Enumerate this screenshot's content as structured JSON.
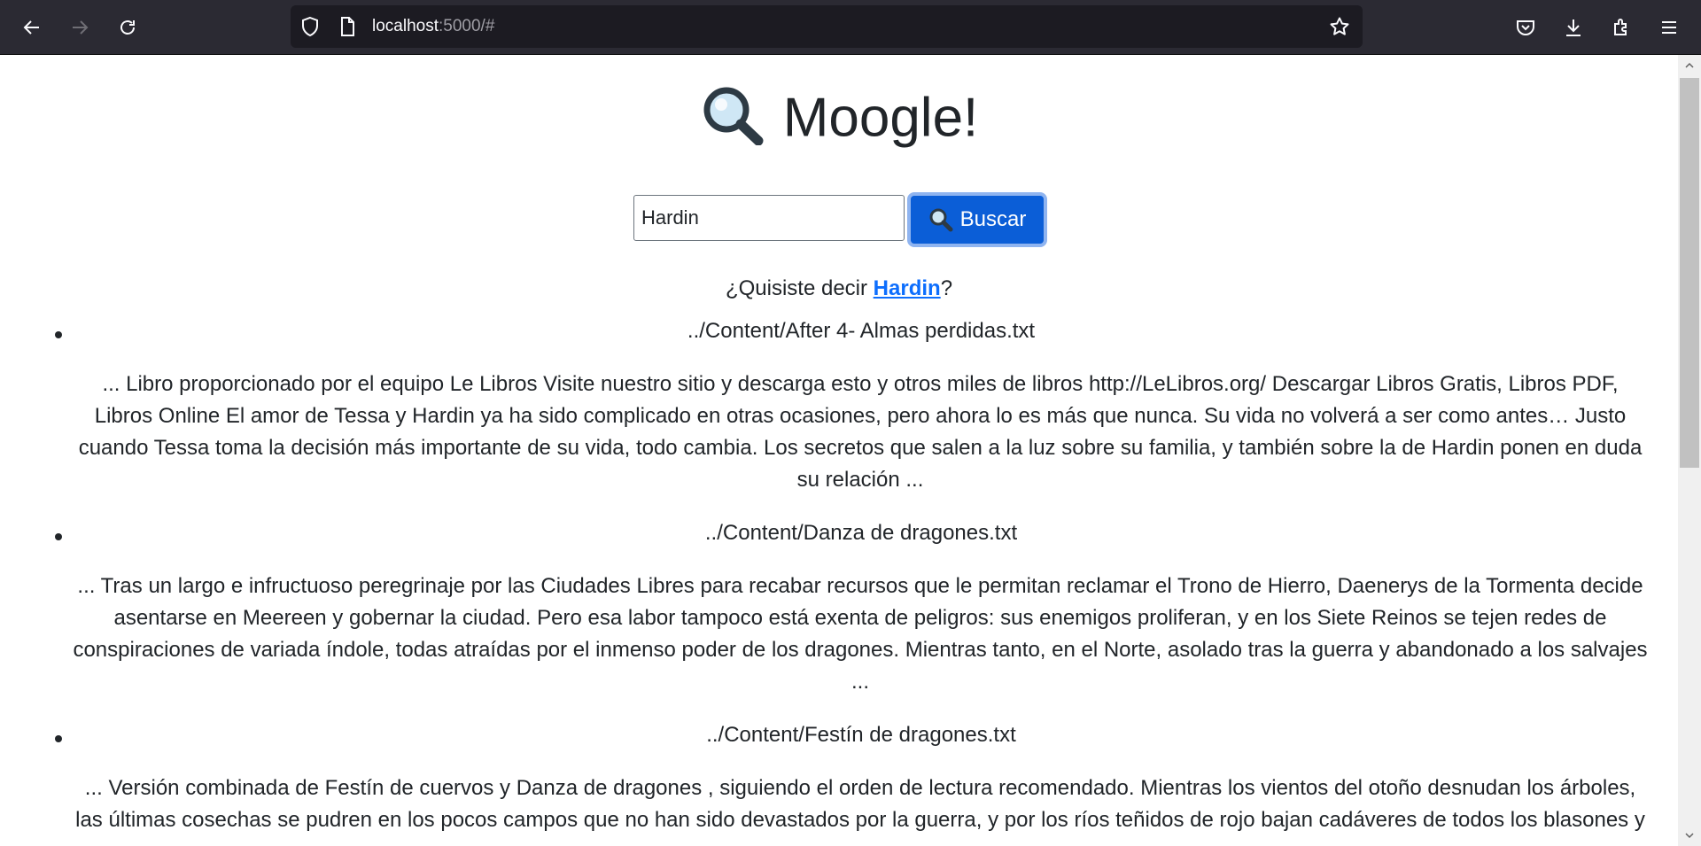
{
  "browser": {
    "url_host": "localhost",
    "url_rest": ":5000/#"
  },
  "page": {
    "title": "Moogle!",
    "search_value": "Hardin",
    "search_button_label": "Buscar",
    "suggest_prefix": "¿Quisiste decir ",
    "suggest_word": "Hardin",
    "suggest_suffix": "?",
    "results": [
      {
        "file": "../Content/After 4- Almas perdidas.txt",
        "snippet": "... Libro proporcionado por el equipo Le Libros Visite nuestro sitio y descarga esto y otros miles de libros http://LeLibros.org/ Descargar Libros Gratis, Libros PDF, Libros Online El amor de Tessa y Hardin ya ha sido complicado en otras ocasiones, pero ahora lo es más que nunca. Su vida no volverá a ser como antes… Justo cuando Tessa toma la decisión más importante de su vida, todo cambia. Los secretos que salen a la luz sobre su familia, y también sobre la de Hardin ponen en duda su relación ..."
      },
      {
        "file": "../Content/Danza de dragones.txt",
        "snippet": "...  Tras un largo e infructuoso peregrinaje por las Ciudades Libres para recabar recursos que le permitan reclamar el Trono de Hierro, Daenerys de la Tormenta decide asentarse en Meereen y gobernar la ciudad. Pero esa labor tampoco está exenta de peligros: sus enemigos proliferan, y en los Siete Reinos se tejen redes de conspiraciones de variada índole, todas atraídas por el inmenso poder de los dragones. Mientras tanto, en el Norte, asolado tras la guerra y abandonado a los salvajes ..."
      },
      {
        "file": "../Content/Festín de dragones.txt",
        "snippet": "...  Versión combinada de Festín de cuervos y Danza de dragones , siguiendo el orden de lectura recomendado.  Mientras los vientos del otoño desnudan los árboles, las últimas cosechas se pudren en los pocos campos que no han sido devastados por la guerra, y por los ríos teñidos de rojo bajan cadáveres de todos los blasones y"
      }
    ]
  }
}
